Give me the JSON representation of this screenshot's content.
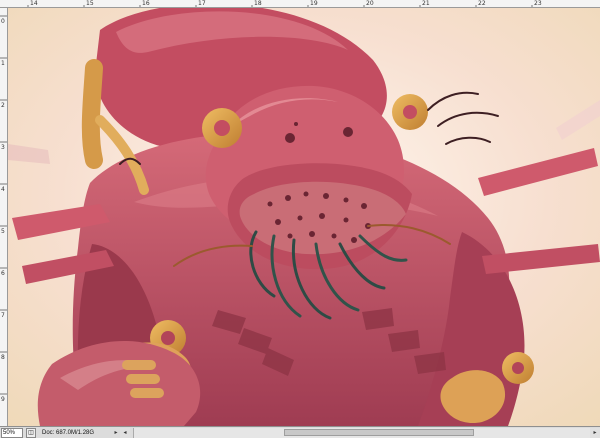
{
  "rulers": {
    "top_labels": [
      "14",
      "15",
      "16",
      "17",
      "18",
      "19",
      "20",
      "21",
      "22",
      "23"
    ],
    "left_labels": [
      "0",
      "1",
      "2",
      "3",
      "4",
      "5",
      "6",
      "7",
      "8",
      "9"
    ]
  },
  "status_bar": {
    "zoom": "50%",
    "doc_info": "Doc: 687.0M/1.28G"
  },
  "colors": {
    "robot_red": "#b5485d",
    "gear_gold": "#d19a47",
    "background_glow": "#f6e7d4"
  }
}
